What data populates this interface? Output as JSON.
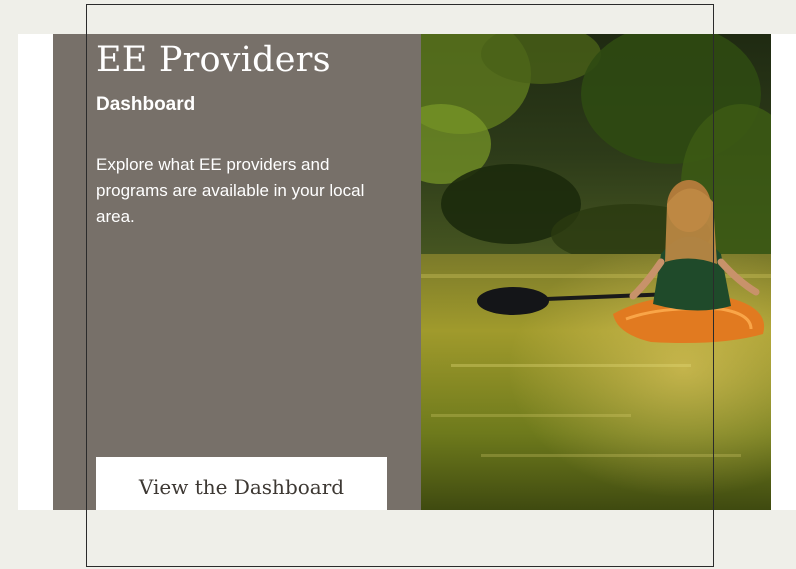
{
  "card": {
    "title": "EE Providers",
    "subtitle": "Dashboard",
    "description": "Explore what EE providers and programs are available in your local area.",
    "button_label": "View the Dashboard"
  },
  "photo": {
    "icon": "kayak-river-photo"
  },
  "colors": {
    "page_background": "#efefe9",
    "panel": "#777069",
    "button": "#ffffff",
    "button_text": "#3d3833",
    "text": "#ffffff"
  }
}
